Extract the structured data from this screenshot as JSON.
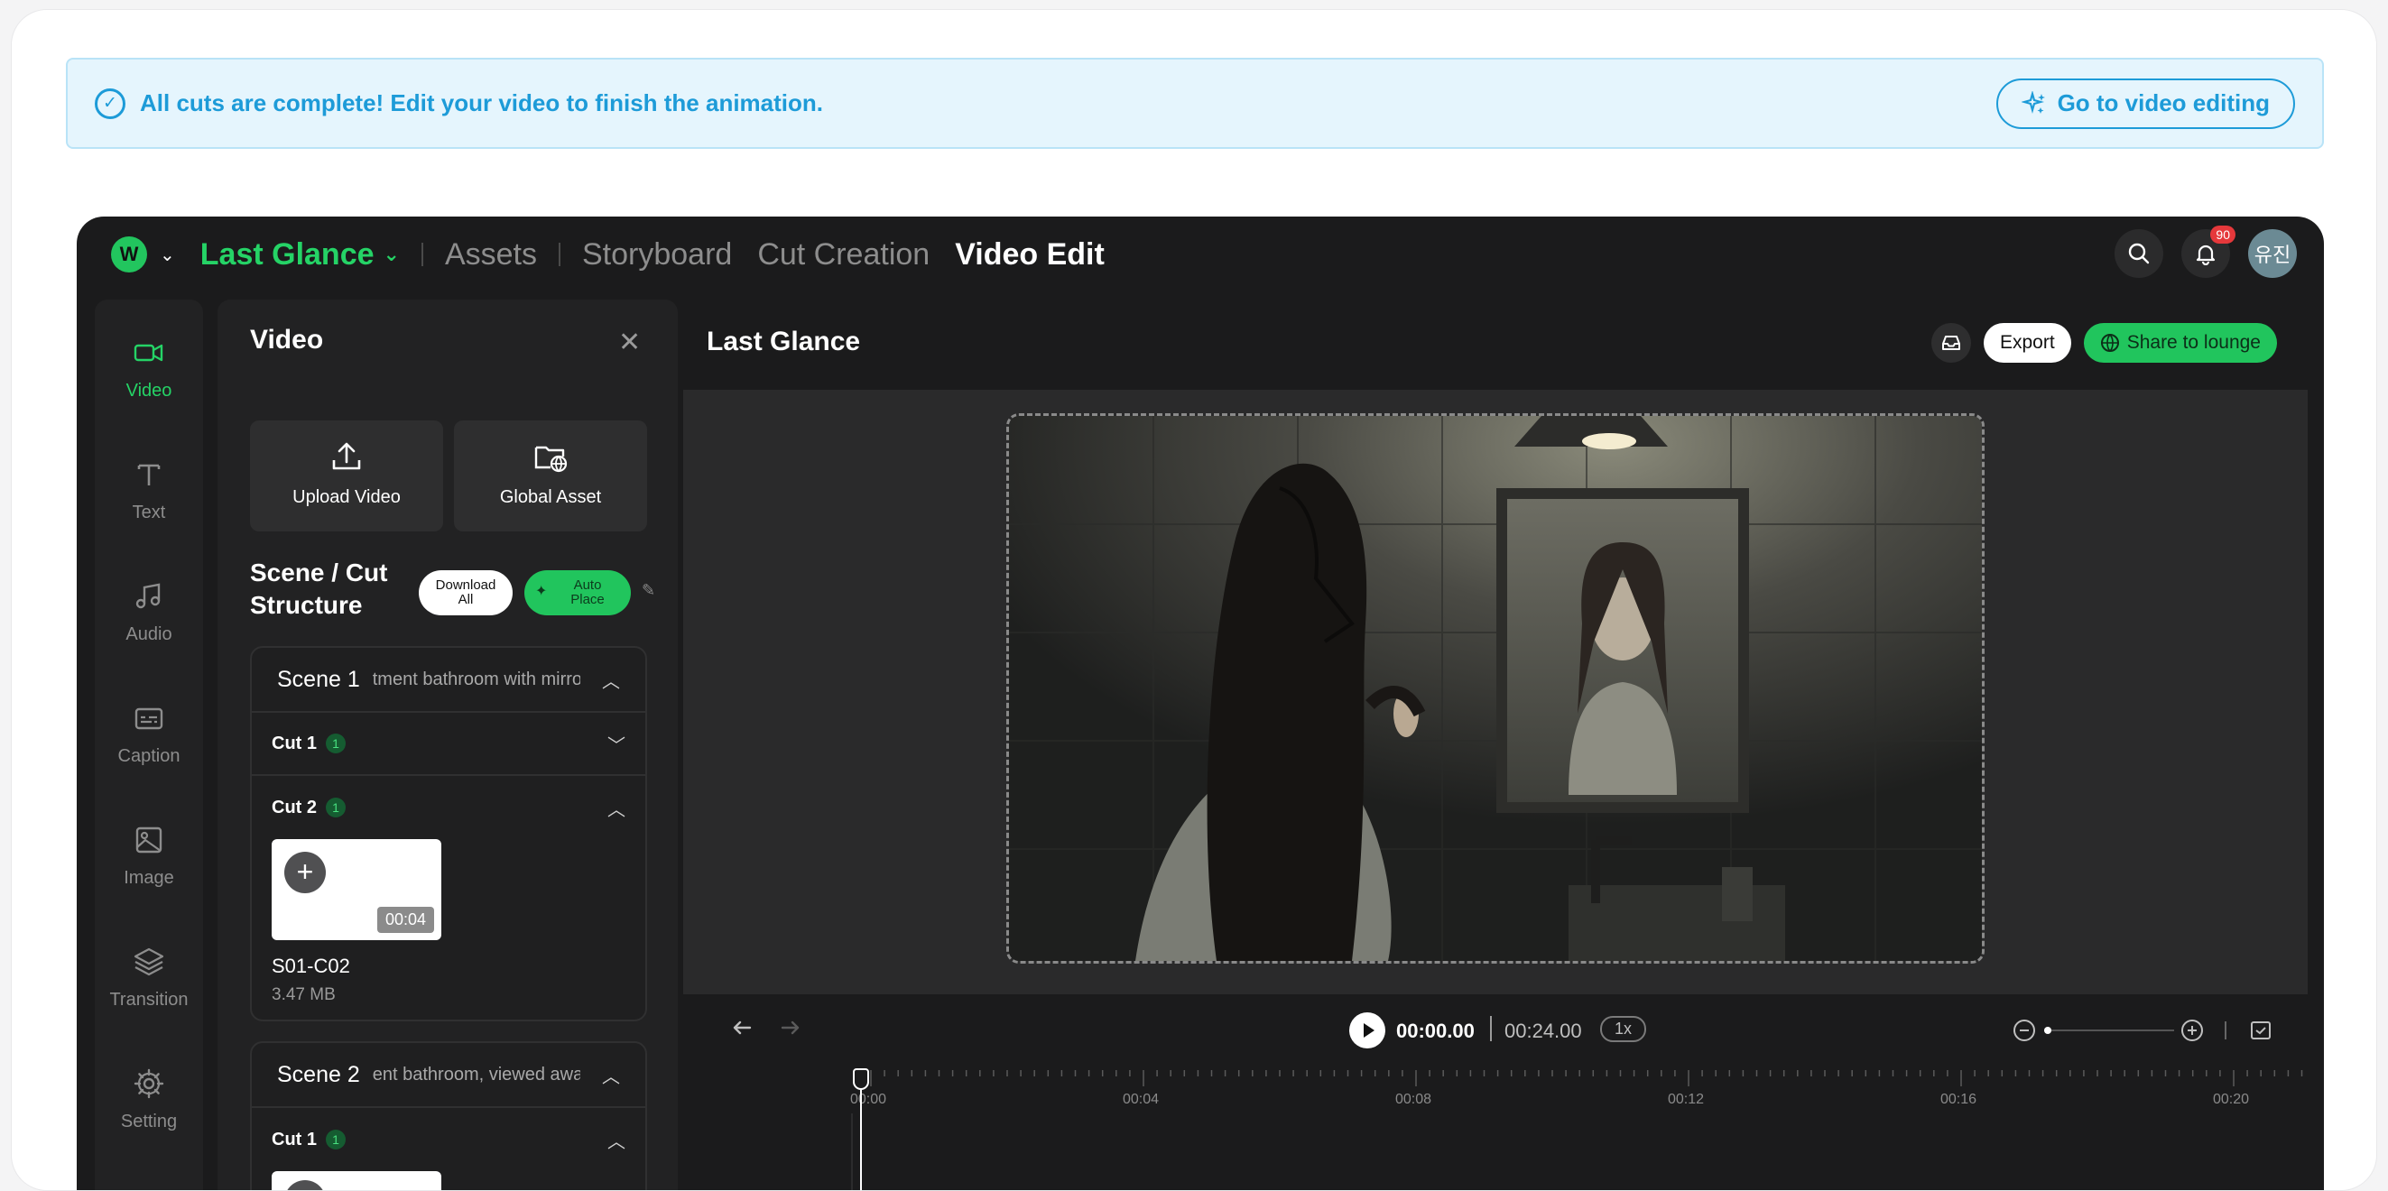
{
  "banner": {
    "message": "All cuts are complete! Edit your video to finish the animation.",
    "button_label": "Go to video editing"
  },
  "topbar": {
    "project_title": "Last Glance",
    "nav": [
      "Assets",
      "Storyboard",
      "Cut Creation",
      "Video Edit"
    ],
    "active_nav": "Video Edit",
    "notification_count": "90",
    "avatar_text": "유진"
  },
  "rail": {
    "items": [
      {
        "label": "Video",
        "icon": "video-camera-icon"
      },
      {
        "label": "Text",
        "icon": "text-icon"
      },
      {
        "label": "Audio",
        "icon": "music-note-icon"
      },
      {
        "label": "Caption",
        "icon": "caption-icon"
      },
      {
        "label": "Image",
        "icon": "image-icon"
      },
      {
        "label": "Transition",
        "icon": "layers-icon"
      },
      {
        "label": "Setting",
        "icon": "gear-icon"
      }
    ]
  },
  "panel": {
    "title": "Video",
    "upload_label": "Upload Video",
    "global_asset_label": "Global Asset",
    "structure_title_1": "Scene / Cut",
    "structure_title_2": "Structure",
    "download_all_1": "Download",
    "download_all_2": "All",
    "auto_place_1": "Auto",
    "auto_place_2": "Place",
    "scenes": [
      {
        "name": "Scene 1",
        "description": "tment bathroom with mirro",
        "cuts": [
          {
            "label": "Cut 1",
            "count": "1"
          },
          {
            "label": "Cut 2",
            "count": "1",
            "clip": {
              "duration": "00:04",
              "name": "S01-C02",
              "size": "3.47 MB"
            }
          }
        ]
      },
      {
        "name": "Scene 2",
        "description": "ent bathroom, viewed awa",
        "cuts": [
          {
            "label": "Cut 1",
            "count": "1"
          }
        ]
      }
    ]
  },
  "editor": {
    "title": "Last Glance",
    "export_label": "Export",
    "share_label": "Share to lounge",
    "current_time": "00:00.00",
    "total_time": "00:24.00",
    "speed": "1x",
    "ticks": [
      "00:00",
      "00:04",
      "00:08",
      "00:12",
      "00:16",
      "00:20"
    ]
  },
  "colors": {
    "accent_green": "#25d366",
    "banner_blue": "#1d9bd8",
    "app_bg": "#1b1b1c"
  }
}
